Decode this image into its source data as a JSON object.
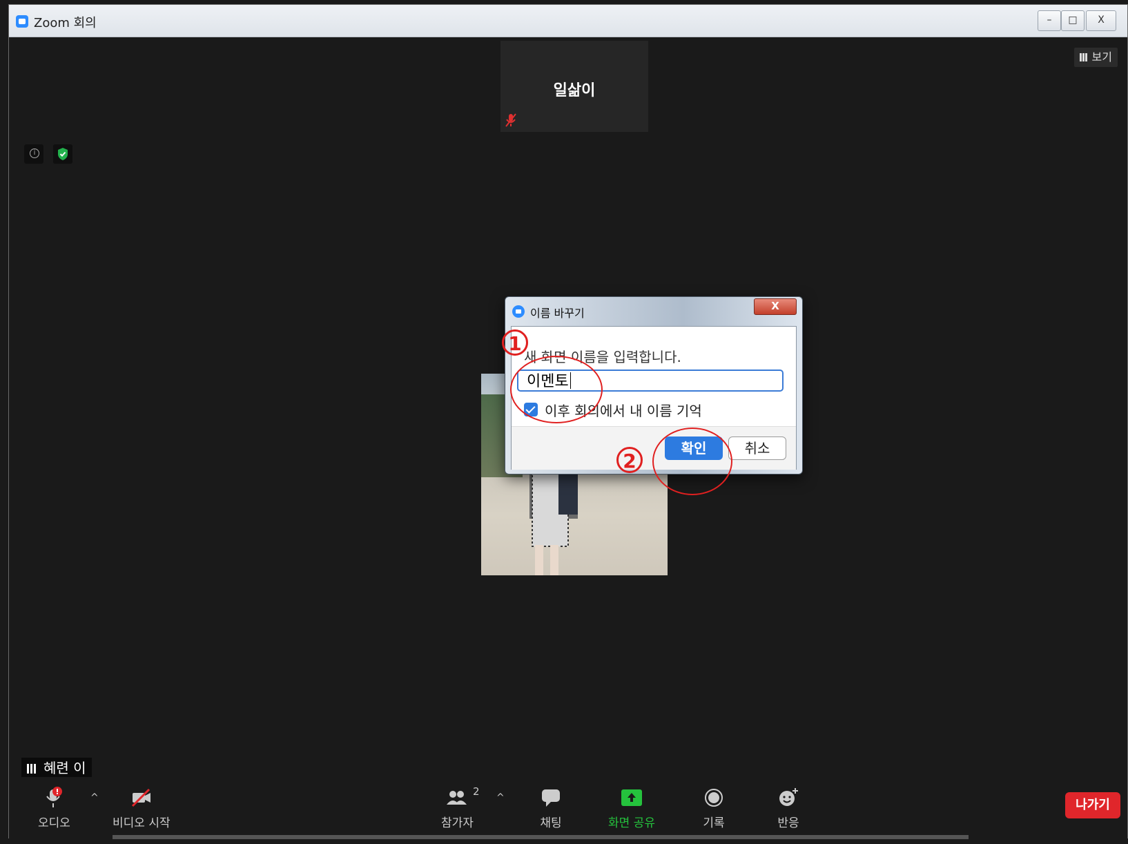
{
  "window": {
    "title": "Zoom 회의",
    "controls": [
      "–",
      "□",
      "X"
    ]
  },
  "view_button": {
    "label": "보기"
  },
  "participant_tile": {
    "name": "일삶이"
  },
  "dialog": {
    "title": "이름 바꾸기",
    "close_label": "X",
    "prompt": "새 화면 이름을 입력합니다.",
    "input_value": "이멘토",
    "remember_label": "이후 회의에서 내 이름 기억",
    "remember_checked": true,
    "ok_label": "확인",
    "cancel_label": "취소"
  },
  "annotations": {
    "step1": "1",
    "step2": "2"
  },
  "self_name_tag": "혜련 이",
  "toolbar": {
    "audio": "오디오",
    "video": "비디오 시작",
    "participants": "참가자",
    "participants_count": "2",
    "chat": "채팅",
    "share": "화면 공유",
    "record": "기록",
    "reactions": "반응",
    "leave": "나가기"
  },
  "colors": {
    "accent": "#2d8cff",
    "leave": "#e0262b",
    "share": "#25c23d",
    "annotation": "#e02020"
  }
}
